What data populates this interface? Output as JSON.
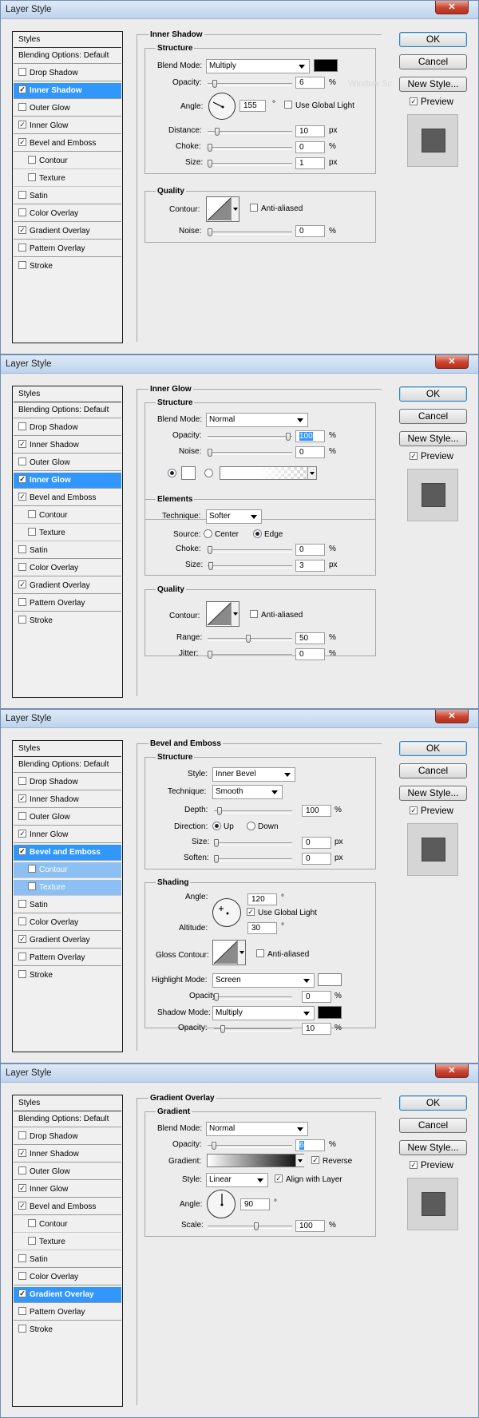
{
  "dialog_title": "Layer Style",
  "close_glyph": "✕",
  "buttons": {
    "ok": "OK",
    "cancel": "Cancel",
    "new_style": "New Style...",
    "preview": "Preview"
  },
  "styles_list": [
    "Styles",
    "Blending Options: Default",
    "Drop Shadow",
    "Inner Shadow",
    "Outer Glow",
    "Inner Glow",
    "Bevel and Emboss",
    "Contour",
    "Texture",
    "Satin",
    "Color Overlay",
    "Gradient Overlay",
    "Pattern Overlay",
    "Stroke"
  ],
  "check_glyph": "✓",
  "checked_effects": [
    "Inner Shadow",
    "Inner Glow",
    "Bevel and Emboss",
    "Gradient Overlay"
  ],
  "panels": {
    "inner_shadow": {
      "section": "Inner Shadow",
      "structure": "Structure",
      "blend_mode_label": "Blend Mode:",
      "blend_mode": "Multiply",
      "color": "#000000",
      "opacity_label": "Opacity:",
      "opacity": "6",
      "opacity_unit": "%",
      "angle_label": "Angle:",
      "angle": "155",
      "angle_unit": "°",
      "use_global_light": "Use Global Light",
      "distance_label": "Distance:",
      "distance": "10",
      "distance_unit": "px",
      "choke_label": "Choke:",
      "choke": "0",
      "choke_unit": "%",
      "size_label": "Size:",
      "size": "1",
      "size_unit": "px",
      "quality": "Quality",
      "contour_label": "Contour:",
      "anti_aliased": "Anti-aliased",
      "noise_label": "Noise:",
      "noise": "0",
      "noise_unit": "%",
      "watermark": "Window Sc"
    },
    "inner_glow": {
      "section": "Inner Glow",
      "structure": "Structure",
      "blend_mode_label": "Blend Mode:",
      "blend_mode": "Normal",
      "opacity_label": "Opacity:",
      "opacity": "100",
      "opacity_unit": "%",
      "noise_label": "Noise:",
      "noise": "0",
      "noise_unit": "%",
      "elements": "Elements",
      "technique_label": "Technique:",
      "technique": "Softer",
      "source_label": "Source:",
      "source_center": "Center",
      "source_edge": "Edge",
      "choke_label": "Choke:",
      "choke": "0",
      "choke_unit": "%",
      "size_label": "Size:",
      "size": "3",
      "size_unit": "px",
      "quality": "Quality",
      "contour_label": "Contour:",
      "anti_aliased": "Anti-aliased",
      "range_label": "Range:",
      "range": "50",
      "range_unit": "%",
      "jitter_label": "Jitter:",
      "jitter": "0",
      "jitter_unit": "%"
    },
    "bevel_emboss": {
      "section": "Bevel and Emboss",
      "structure": "Structure",
      "style_label": "Style:",
      "style": "Inner Bevel",
      "technique_label": "Technique:",
      "technique": "Smooth",
      "depth_label": "Depth:",
      "depth": "100",
      "depth_unit": "%",
      "direction_label": "Direction:",
      "direction_up": "Up",
      "direction_down": "Down",
      "size_label": "Size:",
      "size": "0",
      "size_unit": "px",
      "soften_label": "Soften:",
      "soften": "0",
      "soften_unit": "px",
      "shading": "Shading",
      "angle_label": "Angle:",
      "angle": "120",
      "angle_unit": "°",
      "use_global_light": "Use Global Light",
      "altitude_label": "Altitude:",
      "altitude": "30",
      "altitude_unit": "°",
      "gloss_contour_label": "Gloss Contour:",
      "anti_aliased": "Anti-aliased",
      "highlight_mode_label": "Highlight Mode:",
      "highlight_mode": "Screen",
      "highlight_color": "#ffffff",
      "highlight_opacity_label": "Opacity:",
      "highlight_opacity": "0",
      "highlight_opacity_unit": "%",
      "shadow_mode_label": "Shadow Mode:",
      "shadow_mode": "Multiply",
      "shadow_color": "#000000",
      "shadow_opacity_label": "Opacity:",
      "shadow_opacity": "10",
      "shadow_opacity_unit": "%"
    },
    "gradient_overlay": {
      "section": "Gradient Overlay",
      "gradient_group": "Gradient",
      "blend_mode_label": "Blend Mode:",
      "blend_mode": "Normal",
      "opacity_label": "Opacity:",
      "opacity": "6",
      "opacity_unit": "%",
      "gradient_label": "Gradient:",
      "reverse": "Reverse",
      "style_label": "Style:",
      "style": "Linear",
      "align_with_layer": "Align with Layer",
      "angle_label": "Angle:",
      "angle": "90",
      "angle_unit": "°",
      "scale_label": "Scale:",
      "scale": "100",
      "scale_unit": "%"
    }
  }
}
